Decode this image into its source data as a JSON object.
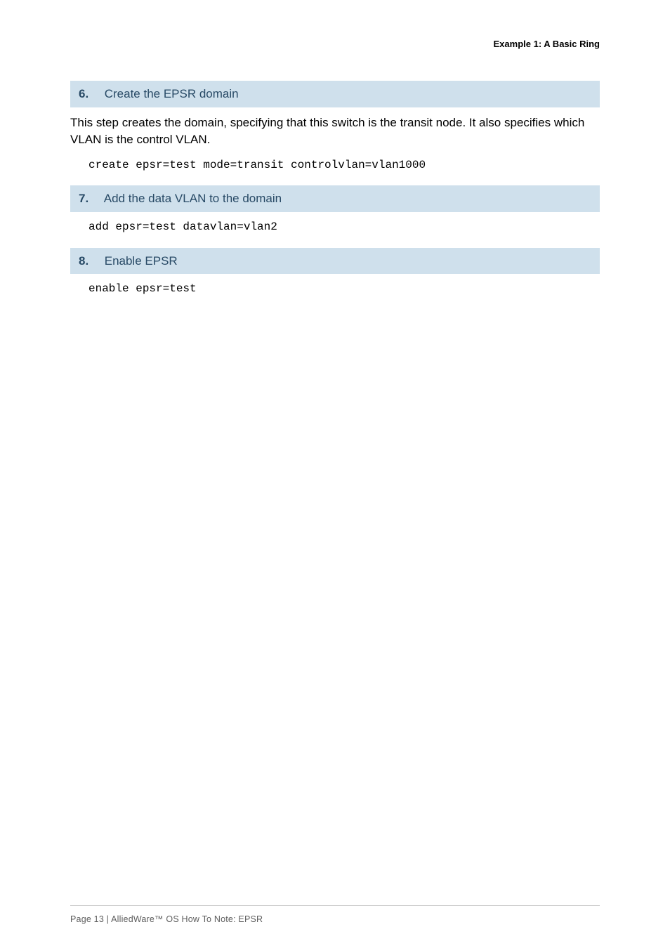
{
  "runningHead": "Example 1: A Basic Ring",
  "steps": {
    "s6": {
      "num": "6.",
      "title": "Create the EPSR domain"
    },
    "s7": {
      "num": "7.",
      "title": "Add the data VLAN to the domain"
    },
    "s8": {
      "num": "8.",
      "title": "Enable EPSR"
    }
  },
  "para1": "This step creates the domain, specifying that this switch is the transit node. It also specifies which VLAN is the control VLAN.",
  "code": {
    "c1": "create epsr=test mode=transit controlvlan=vlan1000",
    "c2": "add epsr=test datavlan=vlan2",
    "c3": "enable epsr=test"
  },
  "footer": "Page 13 | AlliedWare™ OS How To Note: EPSR"
}
